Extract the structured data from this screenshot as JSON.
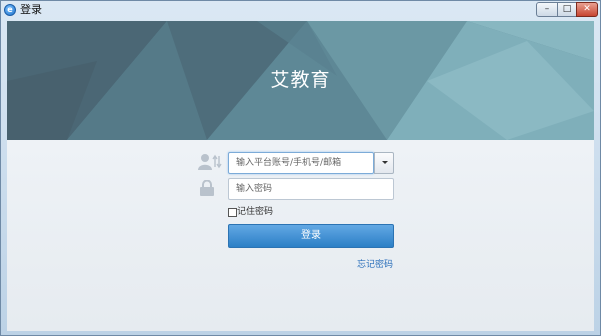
{
  "window": {
    "title": "登录",
    "minimize_symbol": "–",
    "maximize_symbol": "□",
    "close_symbol": "✕"
  },
  "banner": {
    "brand_name": "艾教育",
    "colors": {
      "dark": "#4e6a78",
      "mid": "#5d8694",
      "light": "#8ab7c2"
    }
  },
  "form": {
    "account_placeholder": "输入平台账号/手机号/邮箱",
    "password_placeholder": "输入密码",
    "remember_label": "记住密码",
    "remember_checked": false,
    "login_label": "登录",
    "forgot_label": "忘记密码",
    "accent_color": "#3a8ad0"
  },
  "icons": [
    "app-logo-icon",
    "user-switch-icon",
    "lock-icon",
    "chevron-down-icon"
  ]
}
